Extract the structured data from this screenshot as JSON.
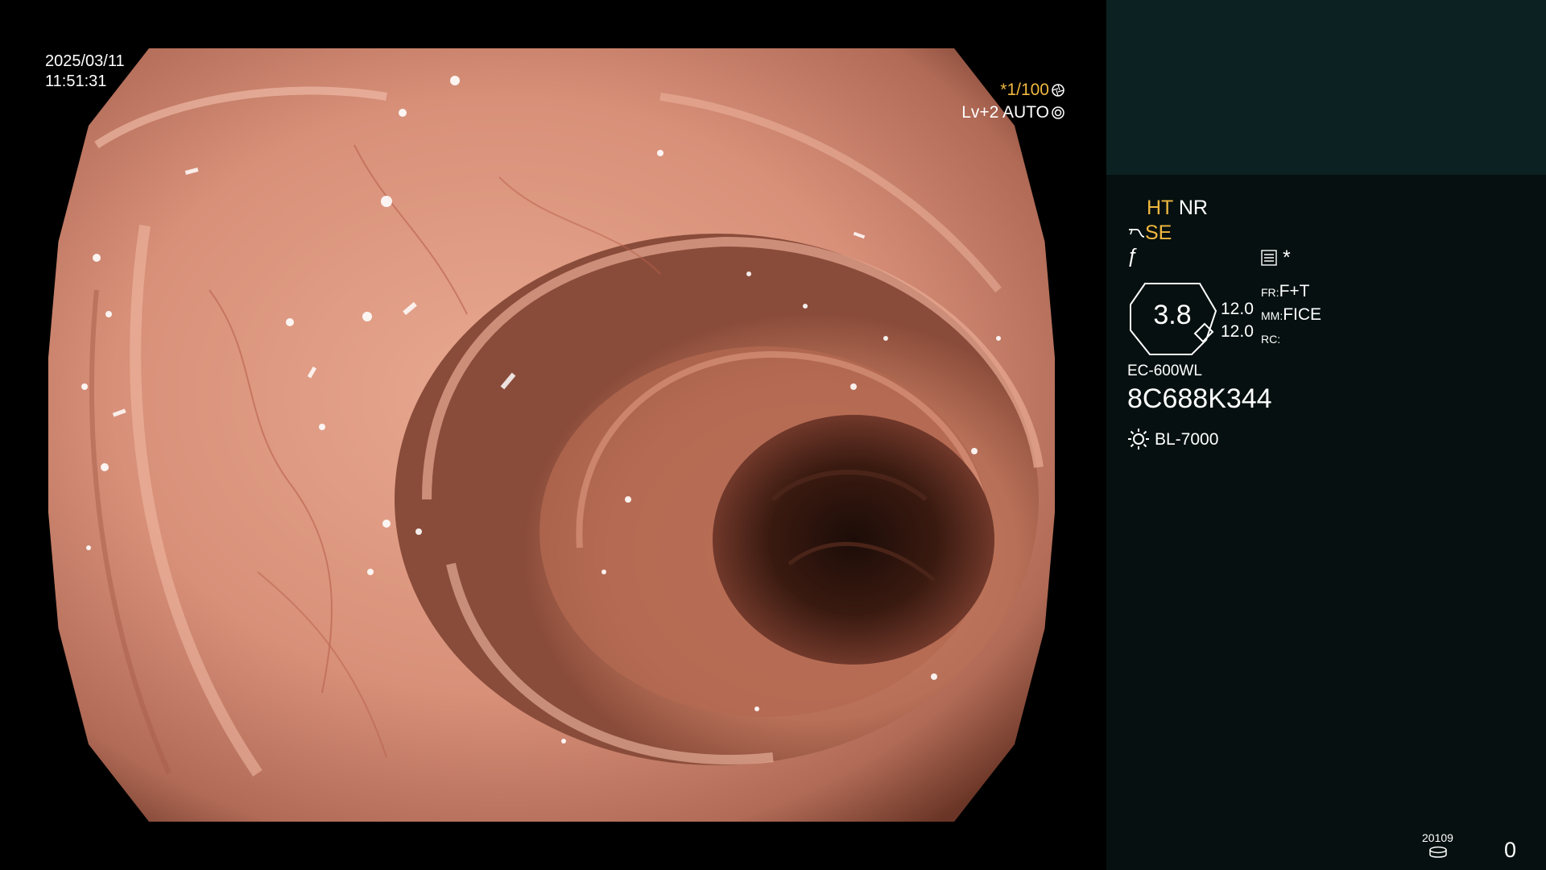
{
  "overlay": {
    "date": "2025/03/11",
    "time": "11:51:31",
    "shutter": "*1/100",
    "shutter_icon": "shutter-icon",
    "iris": "Lv+2 AUTO",
    "iris_icon": "iris-icon"
  },
  "panel": {
    "ht_label": "HT",
    "nr_label": "NR",
    "se_label": "SE",
    "se_icon": "scope-curve-icon",
    "f_label": "ƒ",
    "menu_icon": "menu-list-icon",
    "star_label": "*",
    "zoom_value": "3.8",
    "num_top": "12.0",
    "num_bottom": "12.0",
    "fr_label": "FR:",
    "fr_value": "F+T",
    "mm_label": "MM:",
    "mm_value": "FICE",
    "rc_label": "RC:",
    "rc_value": "",
    "scope_model": "EC-600WL",
    "serial": "8C688K344",
    "light_icon": "sun-icon",
    "light_source": "BL-7000",
    "counter_label": "20109",
    "disk_icon": "disk-icon",
    "counter_value": "0"
  },
  "colors": {
    "panel_bg": "#061010",
    "thumb_bg": "#0c2222",
    "highlight": "#f0b840",
    "text": "#ffffff"
  }
}
